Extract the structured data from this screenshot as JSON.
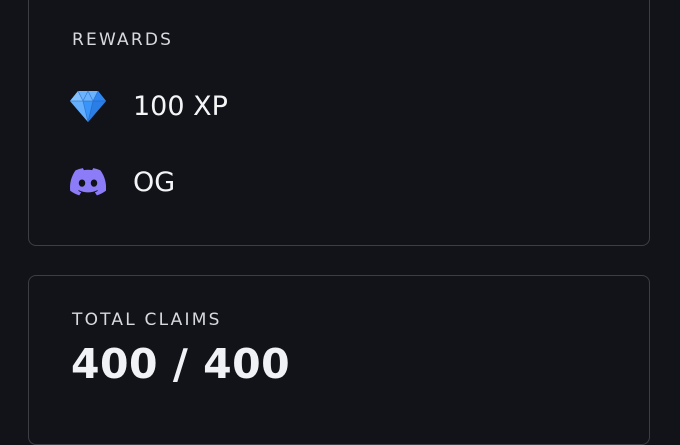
{
  "rewards": {
    "label": "REWARDS",
    "items": [
      {
        "icon": "diamond-icon",
        "text": "100 XP",
        "color": "#4da3ff"
      },
      {
        "icon": "discord-icon",
        "text": "OG",
        "color": "#8c7cf7"
      }
    ]
  },
  "claims": {
    "label": "TOTAL CLAIMS",
    "value": "400 / 400"
  },
  "colors": {
    "background": "#121318",
    "border": "#3c3e45",
    "text": "#f1f2f5"
  }
}
